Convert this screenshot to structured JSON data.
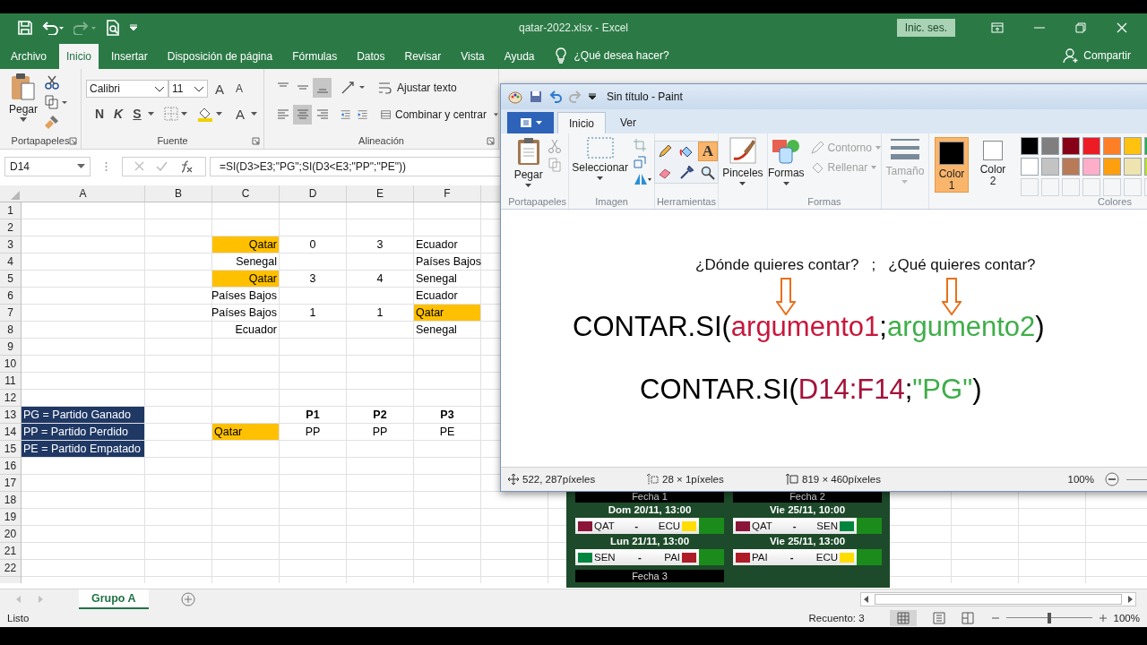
{
  "excel": {
    "title": "qatar-2022.xlsx  -  Excel",
    "sign_in": "Inic. ses.",
    "menu_tabs": [
      {
        "label": "Archivo",
        "selected": false
      },
      {
        "label": "Inicio",
        "selected": true
      },
      {
        "label": "Insertar",
        "selected": false
      },
      {
        "label": "Disposición de página",
        "selected": false
      },
      {
        "label": "Fórmulas",
        "selected": false
      },
      {
        "label": "Datos",
        "selected": false
      },
      {
        "label": "Revisar",
        "selected": false
      },
      {
        "label": "Vista",
        "selected": false
      },
      {
        "label": "Ayuda",
        "selected": false
      }
    ],
    "tell_me": "¿Qué desea hacer?",
    "share": "Compartir",
    "ribbon": {
      "clipboard": {
        "paste": "Pegar",
        "group": "Portapapeles"
      },
      "font": {
        "family": "Calibri",
        "size": "11",
        "grow": "A",
        "shrink": "A",
        "bold": "N",
        "italic": "K",
        "underline": "S",
        "font_color": "A",
        "group": "Fuente"
      },
      "alignment": {
        "vertical": [
          {
            "kind": "top",
            "selected": false
          },
          {
            "kind": "middle",
            "selected": false
          },
          {
            "kind": "bottom",
            "selected": true
          }
        ],
        "horizontal": [
          {
            "kind": "left",
            "selected": false
          },
          {
            "kind": "center",
            "selected": true
          },
          {
            "kind": "right",
            "selected": false
          }
        ],
        "wrap": "Ajustar texto",
        "merge": "Combinar y centrar",
        "group": "Alineación"
      }
    },
    "name_box": "D14",
    "formula": "=SI(D3>E3;\"PG\";SI(D3<E3;\"PP\";\"PE\"))",
    "columns": [
      "A",
      "B",
      "C",
      "D",
      "E",
      "F"
    ],
    "rows": [
      {
        "number": "1"
      },
      {
        "number": "2"
      },
      {
        "number": "3",
        "cells": [
          null,
          null,
          {
            "text": "Qatar",
            "kind": "right",
            "color": "#ffc000"
          },
          {
            "text": "0",
            "kind": "center"
          },
          {
            "text": "3",
            "kind": "center"
          },
          {
            "text": "Ecuador",
            "kind": "left"
          }
        ]
      },
      {
        "number": "4",
        "cells": [
          null,
          null,
          {
            "text": "Senegal",
            "kind": "right"
          },
          null,
          null,
          {
            "text": "Países Bajos",
            "kind": "left"
          }
        ]
      },
      {
        "number": "5",
        "cells": [
          null,
          null,
          {
            "text": "Qatar",
            "kind": "right",
            "color": "#ffc000"
          },
          {
            "text": "3",
            "kind": "center"
          },
          {
            "text": "4",
            "kind": "center"
          },
          {
            "text": "Senegal",
            "kind": "left"
          }
        ]
      },
      {
        "number": "6",
        "cells": [
          null,
          null,
          {
            "text": "Países Bajos",
            "kind": "right"
          },
          null,
          null,
          {
            "text": "Ecuador",
            "kind": "left"
          }
        ]
      },
      {
        "number": "7",
        "cells": [
          null,
          null,
          {
            "text": "Países Bajos",
            "kind": "right"
          },
          {
            "text": "1",
            "kind": "center"
          },
          {
            "text": "1",
            "kind": "center"
          },
          {
            "text": "Qatar",
            "kind": "left",
            "color": "#ffc000"
          }
        ]
      },
      {
        "number": "8",
        "cells": [
          null,
          null,
          {
            "text": "Ecuador",
            "kind": "right"
          },
          null,
          null,
          {
            "text": "Senegal",
            "kind": "left"
          }
        ]
      },
      {
        "number": "9"
      },
      {
        "number": "10"
      },
      {
        "number": "11"
      },
      {
        "number": "12"
      },
      {
        "number": "13",
        "cells": [
          {
            "text": "PG = Partido Ganado",
            "kind": "left",
            "color": "#1f3864"
          },
          null,
          null,
          {
            "text": "P1",
            "kind": "center",
            "bold": true
          },
          {
            "text": "P2",
            "kind": "center",
            "bold": true
          },
          {
            "text": "P3",
            "kind": "center",
            "bold": true
          }
        ]
      },
      {
        "number": "14",
        "cells": [
          {
            "text": "PP = Partido Perdido",
            "kind": "left",
            "color": "#1f3864"
          },
          null,
          {
            "text": "Qatar",
            "kind": "left",
            "color": "#ffc000"
          },
          {
            "text": "PP",
            "kind": "center"
          },
          {
            "text": "PP",
            "kind": "center"
          },
          {
            "text": "PE",
            "kind": "center"
          }
        ]
      },
      {
        "number": "15",
        "cells": [
          {
            "text": "PE = Partido Empatado",
            "kind": "left",
            "color": "#1f3864"
          },
          null,
          null,
          null,
          null,
          null
        ]
      },
      {
        "number": "16"
      },
      {
        "number": "17"
      },
      {
        "number": "18"
      },
      {
        "number": "19"
      },
      {
        "number": "20"
      },
      {
        "number": "21"
      },
      {
        "number": "22"
      }
    ],
    "schedule": [
      {
        "rounds": [
          {
            "heading": "Fecha 1",
            "days": [
              {
                "date": "Dom 20/11, 13:00",
                "home": {
                  "code": "QAT",
                  "color": "#8a1538"
                },
                "separator": "-",
                "away": {
                  "code": "ECU",
                  "color": "#ffdd00"
                }
              },
              {
                "date": "Lun 21/11, 13:00",
                "home": {
                  "code": "SEN",
                  "color": "#00853f"
                },
                "separator": "-",
                "away": {
                  "code": "PAI",
                  "color": "#ae1c28"
                }
              }
            ]
          },
          {
            "heading": "Fecha 3"
          }
        ]
      },
      {
        "rounds": [
          {
            "heading": "Fecha 2",
            "days": [
              {
                "date": "Vie 25/11, 10:00",
                "home": {
                  "code": "QAT",
                  "color": "#8a1538"
                },
                "separator": "-",
                "away": {
                  "code": "SEN",
                  "color": "#00853f"
                }
              },
              {
                "date": "Vie 25/11, 13:00",
                "home": {
                  "code": "PAI",
                  "color": "#ae1c28"
                },
                "separator": "-",
                "away": {
                  "code": "ECU",
                  "color": "#ffdd00"
                }
              }
            ]
          }
        ]
      }
    ],
    "sheet_tabs": [
      {
        "label": "Grupo A",
        "selected": true
      }
    ],
    "status": "Listo",
    "count": "Recuento: 3",
    "zoom": {
      "label": "100%",
      "level": 0.5
    }
  },
  "paint": {
    "title": "Sin título - Paint",
    "tabs": [
      {
        "label": "Inicio",
        "selected": true
      },
      {
        "label": "Ver",
        "selected": false
      }
    ],
    "clipboard": {
      "paste": "Pegar",
      "group": "Portapapeles"
    },
    "image": {
      "select": "Seleccionar",
      "group": "Imagen"
    },
    "tools": {
      "group": "Herramientas",
      "items": [
        {
          "kind": "pencil",
          "selected": false
        },
        {
          "kind": "fill",
          "selected": false
        },
        {
          "kind": "text",
          "label": "A",
          "selected": true
        },
        {
          "kind": "eraser",
          "selected": false
        },
        {
          "kind": "picker",
          "selected": false
        },
        {
          "kind": "magnifier",
          "selected": false
        }
      ]
    },
    "brushes": "Pinceles",
    "shapes": {
      "label": "Formas",
      "outline": "Contorno",
      "fill": "Rellenar",
      "group": "Formas"
    },
    "size": "Tamaño",
    "color1": {
      "label": "Color",
      "number": "1",
      "color": "#000000",
      "selected": true
    },
    "color2": {
      "label": "Color",
      "number": "2",
      "color": "#ffffff",
      "selected": false
    },
    "palette": [
      {
        "color": "#000000"
      },
      {
        "color": "#7f7f7f"
      },
      {
        "color": "#880015"
      },
      {
        "color": "#ed1c24"
      },
      {
        "color": "#ff7f27"
      },
      {
        "color": "#ffc20e"
      },
      {
        "color": "#22b14c"
      },
      {
        "color": "#ffffff"
      },
      {
        "color": "#c3c3c3"
      },
      {
        "color": "#b97a57"
      },
      {
        "color": "#ffaec9"
      },
      {
        "color": "#ff9f0e"
      },
      {
        "color": "#efe4b0"
      },
      {
        "color": "#b5e61d"
      }
    ],
    "colors_group": "Colores",
    "canvas": {
      "questions": [
        "¿Dónde quieres contar?",
        ";",
        "¿Qué quieres contar?"
      ],
      "formulas": [
        {
          "parts": [
            {
              "text": "CONTAR.SI(",
              "color": "#000000"
            },
            {
              "text": "argumento1",
              "color": "#c8173c"
            },
            {
              "text": ";",
              "color": "#000000"
            },
            {
              "text": "argumento2",
              "color": "#3fae49"
            },
            {
              "text": ")",
              "color": "#000000"
            }
          ]
        },
        {
          "parts": [
            {
              "text": "CONTAR.SI(",
              "color": "#000000"
            },
            {
              "text": "D14:F14",
              "color": "#a3123a"
            },
            {
              "text": ";",
              "color": "#000000"
            },
            {
              "text": "\"PG\"",
              "color": "#3fae49"
            },
            {
              "text": ")",
              "color": "#000000"
            }
          ]
        }
      ]
    },
    "status": {
      "cursor": "522, 287píxeles",
      "selection": "28 × 1píxeles",
      "size": "819 × 460píxeles",
      "zoom": "100%"
    }
  }
}
